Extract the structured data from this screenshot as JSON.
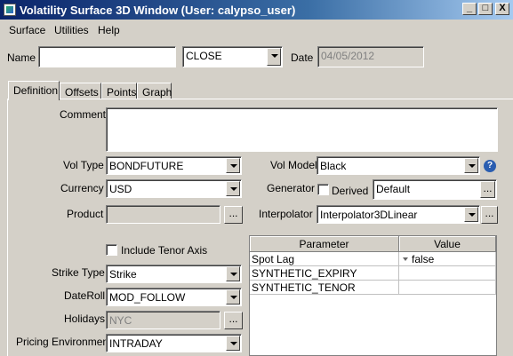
{
  "window": {
    "title": "Volatility Surface 3D Window (User: calypso_user)",
    "controls": [
      "_",
      "□",
      "X"
    ]
  },
  "menu": [
    "Surface",
    "Utilities",
    "Help"
  ],
  "header": {
    "name_label": "Name",
    "name_value": "",
    "close_value": "CLOSE",
    "date_label": "Date",
    "date_value": "04/05/2012"
  },
  "tabs": [
    "Definition",
    "Offsets",
    "Points",
    "Graph"
  ],
  "definition": {
    "comment_label": "Comment",
    "comment_value": "",
    "vol_type_label": "Vol Type",
    "vol_type_value": "BONDFUTURE",
    "currency_label": "Currency",
    "currency_value": "USD",
    "product_label": "Product",
    "product_value": "",
    "include_tenor_label": "Include Tenor Axis",
    "strike_type_label": "Strike Type",
    "strike_type_value": "Strike",
    "dateroll_label": "DateRoll",
    "dateroll_value": "MOD_FOLLOW",
    "holidays_label": "Holidays",
    "holidays_value": "NYC",
    "pricing_env_label": "Pricing Environment",
    "pricing_env_value": "INTRADAY",
    "vol_model_label": "Vol Model",
    "vol_model_value": "Black",
    "generator_label": "Generator",
    "derived_label": "Derived",
    "generator_value": "Default",
    "interpolator_label": "Interpolator",
    "interpolator_value": "Interpolator3DLinear",
    "dots": "..."
  },
  "param_table": {
    "headers": [
      "Parameter",
      "Value"
    ],
    "rows": [
      {
        "param": "Spot Lag",
        "value": "false"
      },
      {
        "param": "SYNTHETIC_EXPIRY",
        "value": ""
      },
      {
        "param": "SYNTHETIC_TENOR",
        "value": ""
      }
    ]
  },
  "colors": {
    "titlebar_start": "#0a246a",
    "titlebar_end": "#a6caf0",
    "face": "#d4d0c8"
  }
}
